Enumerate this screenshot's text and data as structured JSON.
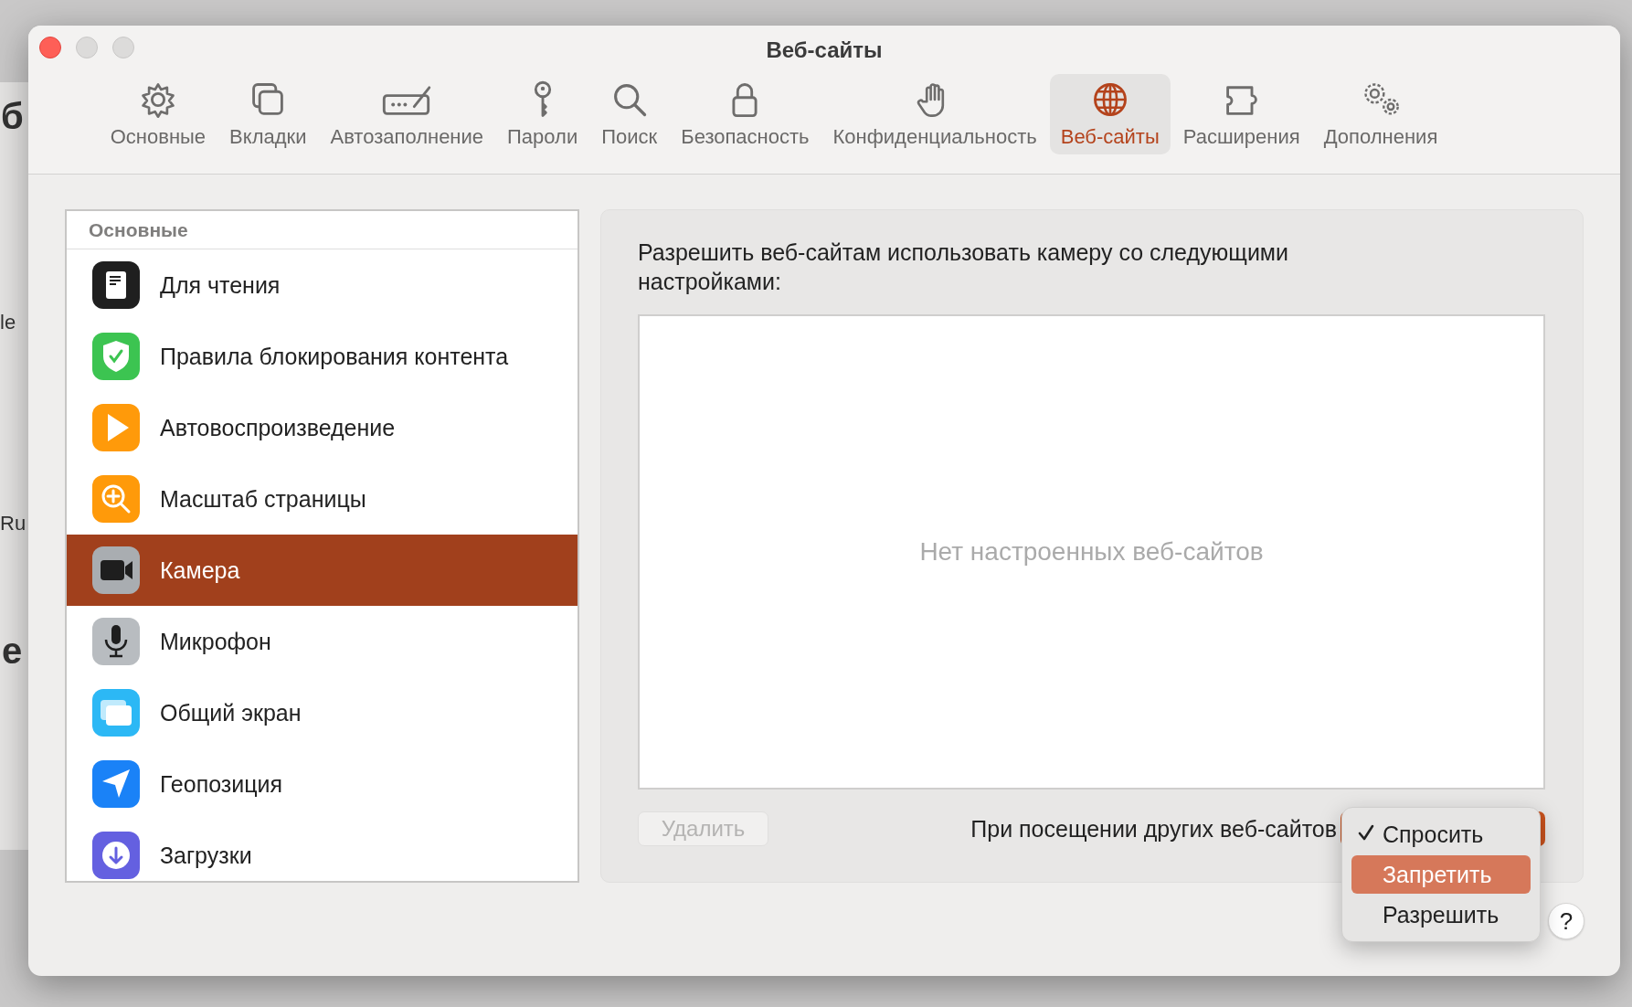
{
  "background_fragments": [
    "б",
    "le",
    "Ru",
    "е"
  ],
  "window": {
    "title": "Веб-сайты"
  },
  "toolbar": [
    {
      "label": "Основные",
      "kind": "gear",
      "selected": false
    },
    {
      "label": "Вкладки",
      "kind": "tabs",
      "selected": false
    },
    {
      "label": "Автозаполнение",
      "kind": "autofill",
      "selected": false
    },
    {
      "label": "Пароли",
      "kind": "key",
      "selected": false
    },
    {
      "label": "Поиск",
      "kind": "search",
      "selected": false
    },
    {
      "label": "Безопасность",
      "kind": "lock",
      "selected": false
    },
    {
      "label": "Конфиденциальность",
      "kind": "hand",
      "selected": false
    },
    {
      "label": "Веб-сайты",
      "kind": "globe",
      "selected": true
    },
    {
      "label": "Расширения",
      "kind": "puzzle",
      "selected": false
    },
    {
      "label": "Дополнения",
      "kind": "gears",
      "selected": false
    }
  ],
  "sidebar": {
    "header": "Основные",
    "items": [
      {
        "label": "Для чтения",
        "kind": "reader",
        "selected": false
      },
      {
        "label": "Правила блокирования контента",
        "kind": "shield",
        "selected": false
      },
      {
        "label": "Автовоспроизведение",
        "kind": "play",
        "selected": false
      },
      {
        "label": "Масштаб страницы",
        "kind": "zoom",
        "selected": false
      },
      {
        "label": "Камера",
        "kind": "camera",
        "selected": true
      },
      {
        "label": "Микрофон",
        "kind": "mic",
        "selected": false
      },
      {
        "label": "Общий экран",
        "kind": "screen",
        "selected": false
      },
      {
        "label": "Геопозиция",
        "kind": "location",
        "selected": false
      },
      {
        "label": "Загрузки",
        "kind": "download",
        "selected": false
      }
    ]
  },
  "panel": {
    "description": "Разрешить веб-сайтам использовать камеру со следующими настройками:",
    "empty_message": "Нет настроенных веб-сайтов",
    "delete_button": {
      "label": "Удалить",
      "disabled": true
    },
    "other_sites_label": "При посещении других веб-сайтов",
    "menu": [
      {
        "label": "Спросить",
        "checked": true,
        "selected": false
      },
      {
        "label": "Запретить",
        "checked": false,
        "selected": true
      },
      {
        "label": "Разрешить",
        "checked": false,
        "selected": false
      }
    ]
  },
  "help_button": "?"
}
